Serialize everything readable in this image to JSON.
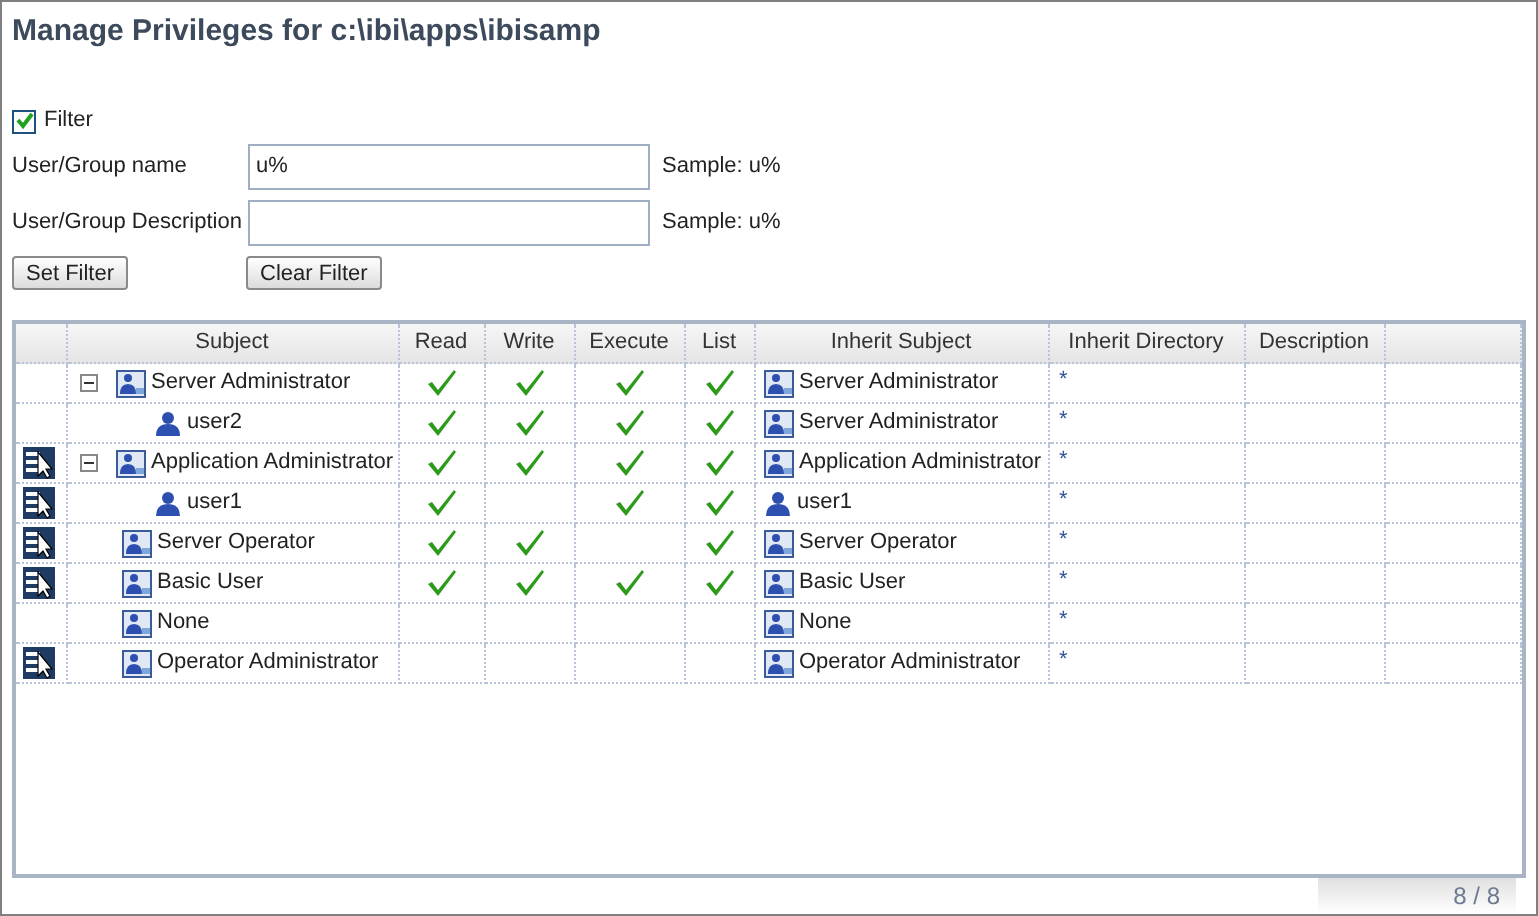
{
  "title": "Manage Privileges for c:\\ibi\\apps\\ibisamp",
  "filter": {
    "label": "Filter",
    "checked": true,
    "fields": [
      {
        "label": "User/Group name",
        "value": "u%",
        "sample": "Sample: u%"
      },
      {
        "label": "User/Group Description",
        "sample": "Sample: u%"
      }
    ],
    "buttons": [
      "Set Filter",
      "Clear Filter"
    ]
  },
  "table": {
    "columns": [
      "Subject",
      "Read",
      "Write",
      "Execute",
      "List",
      "Inherit Subject",
      "Inherit Directory",
      "Description"
    ],
    "rows": [
      {
        "kind": "group",
        "subject": "Server Administrator",
        "editable": false,
        "expanded": true,
        "read": true,
        "write": true,
        "execute": true,
        "list": true,
        "inherit": {
          "kind": "group",
          "subject": "Server Administrator"
        },
        "inherit_directory": "*",
        "children": [
          {
            "kind": "user",
            "subject": "user2",
            "editable": false,
            "read": true,
            "write": true,
            "execute": true,
            "list": true,
            "inherit": {
              "kind": "group",
              "subject": "Server Administrator"
            },
            "inherit_directory": "*"
          }
        ]
      },
      {
        "kind": "group",
        "subject": "Application Administrator",
        "editable": true,
        "expanded": true,
        "read": true,
        "write": true,
        "execute": true,
        "list": true,
        "inherit": {
          "kind": "group",
          "subject": "Application Administrator"
        },
        "inherit_directory": "*",
        "children": [
          {
            "kind": "user",
            "subject": "user1",
            "editable": true,
            "read": true,
            "write": false,
            "execute": true,
            "list": true,
            "inherit": {
              "kind": "user",
              "subject": "user1"
            },
            "inherit_directory": "*"
          }
        ]
      },
      {
        "kind": "group",
        "subject": "Server Operator",
        "editable": true,
        "read": true,
        "write": true,
        "execute": false,
        "list": true,
        "inherit": {
          "kind": "group",
          "subject": "Server Operator"
        },
        "inherit_directory": "*"
      },
      {
        "kind": "group",
        "subject": "Basic User",
        "editable": true,
        "read": true,
        "write": true,
        "execute": true,
        "list": true,
        "inherit": {
          "kind": "group",
          "subject": "Basic User"
        },
        "inherit_directory": "*"
      },
      {
        "kind": "group",
        "subject": "None",
        "editable": false,
        "read": false,
        "write": false,
        "execute": false,
        "list": false,
        "inherit": {
          "kind": "group",
          "subject": "None"
        },
        "inherit_directory": "*"
      },
      {
        "kind": "group",
        "subject": "Operator Administrator",
        "editable": true,
        "read": false,
        "write": false,
        "execute": false,
        "list": false,
        "inherit": {
          "kind": "group",
          "subject": "Operator Administrator"
        },
        "inherit_directory": "*"
      }
    ]
  },
  "pager": "8 / 8"
}
